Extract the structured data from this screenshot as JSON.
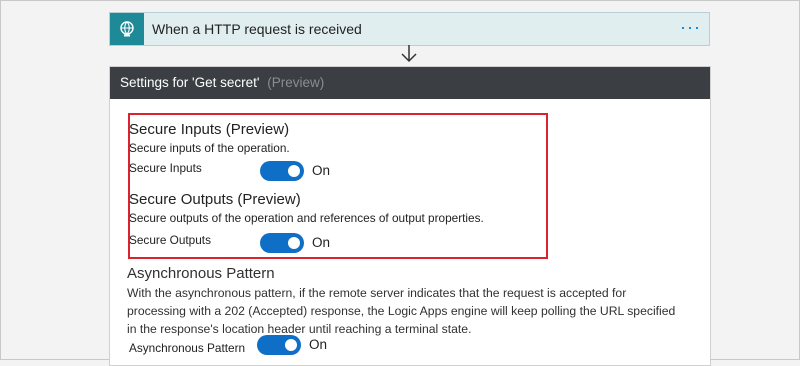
{
  "trigger": {
    "title": "When a HTTP request is received",
    "more_label": "···",
    "icon": "globe-icon",
    "accent_color": "#1f8a97"
  },
  "connector": {
    "icon": "arrow-down-icon"
  },
  "settings": {
    "header_title": "Settings for 'Get secret'",
    "header_suffix": "(Preview)",
    "secure_inputs": {
      "title": "Secure Inputs (Preview)",
      "description": "Secure inputs of the operation.",
      "label": "Secure Inputs",
      "state": "On",
      "enabled": true
    },
    "secure_outputs": {
      "title": "Secure Outputs (Preview)",
      "description": "Secure outputs of the operation and references of output properties.",
      "label": "Secure Outputs",
      "state": "On",
      "enabled": true
    },
    "async": {
      "title": "Asynchronous Pattern",
      "description": "With the asynchronous pattern, if the remote server indicates that the request is accepted for processing with a 202 (Accepted) response, the Logic Apps engine will keep polling the URL specified in the response's location header until reaching a terminal state.",
      "label": "Asynchronous Pattern",
      "state": "On",
      "enabled": true
    },
    "highlight_color": "#d9232e",
    "toggle_color": "#0f6fc6"
  }
}
